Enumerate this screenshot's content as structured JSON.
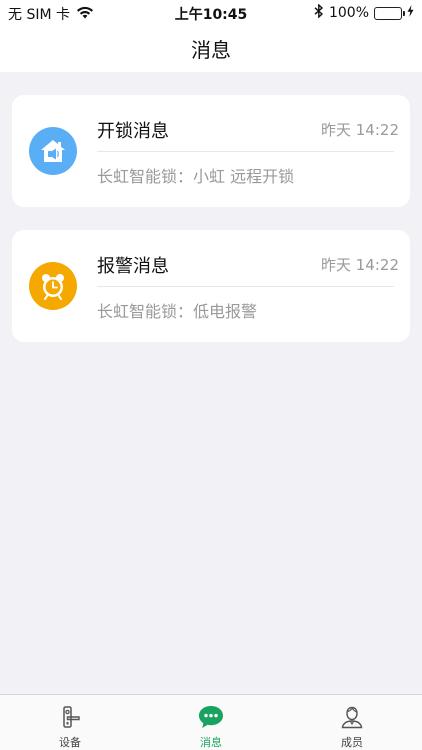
{
  "status_bar": {
    "carrier": "无 SIM 卡",
    "time": "上午10:45",
    "battery": "100%",
    "wifi_icon": "wifi-icon",
    "bluetooth_icon": "bluetooth-icon"
  },
  "header": {
    "title": "消息"
  },
  "messages": [
    {
      "title": "开锁消息",
      "time": "昨天 14:22",
      "body": "长虹智能锁：小虹 远程开锁",
      "icon": "home-lock-icon",
      "icon_color": "#5aaef5"
    },
    {
      "title": "报警消息",
      "time": "昨天 14:22",
      "body": "长虹智能锁：低电报警",
      "icon": "alarm-clock-icon",
      "icon_color": "#f5a800"
    }
  ],
  "tabbar": {
    "active": "消息",
    "accent_color": "#1aa260",
    "items": [
      {
        "label": "设备",
        "icon": "door-lock-icon"
      },
      {
        "label": "消息",
        "icon": "chat-bubble-icon"
      },
      {
        "label": "成员",
        "icon": "member-icon"
      }
    ]
  }
}
